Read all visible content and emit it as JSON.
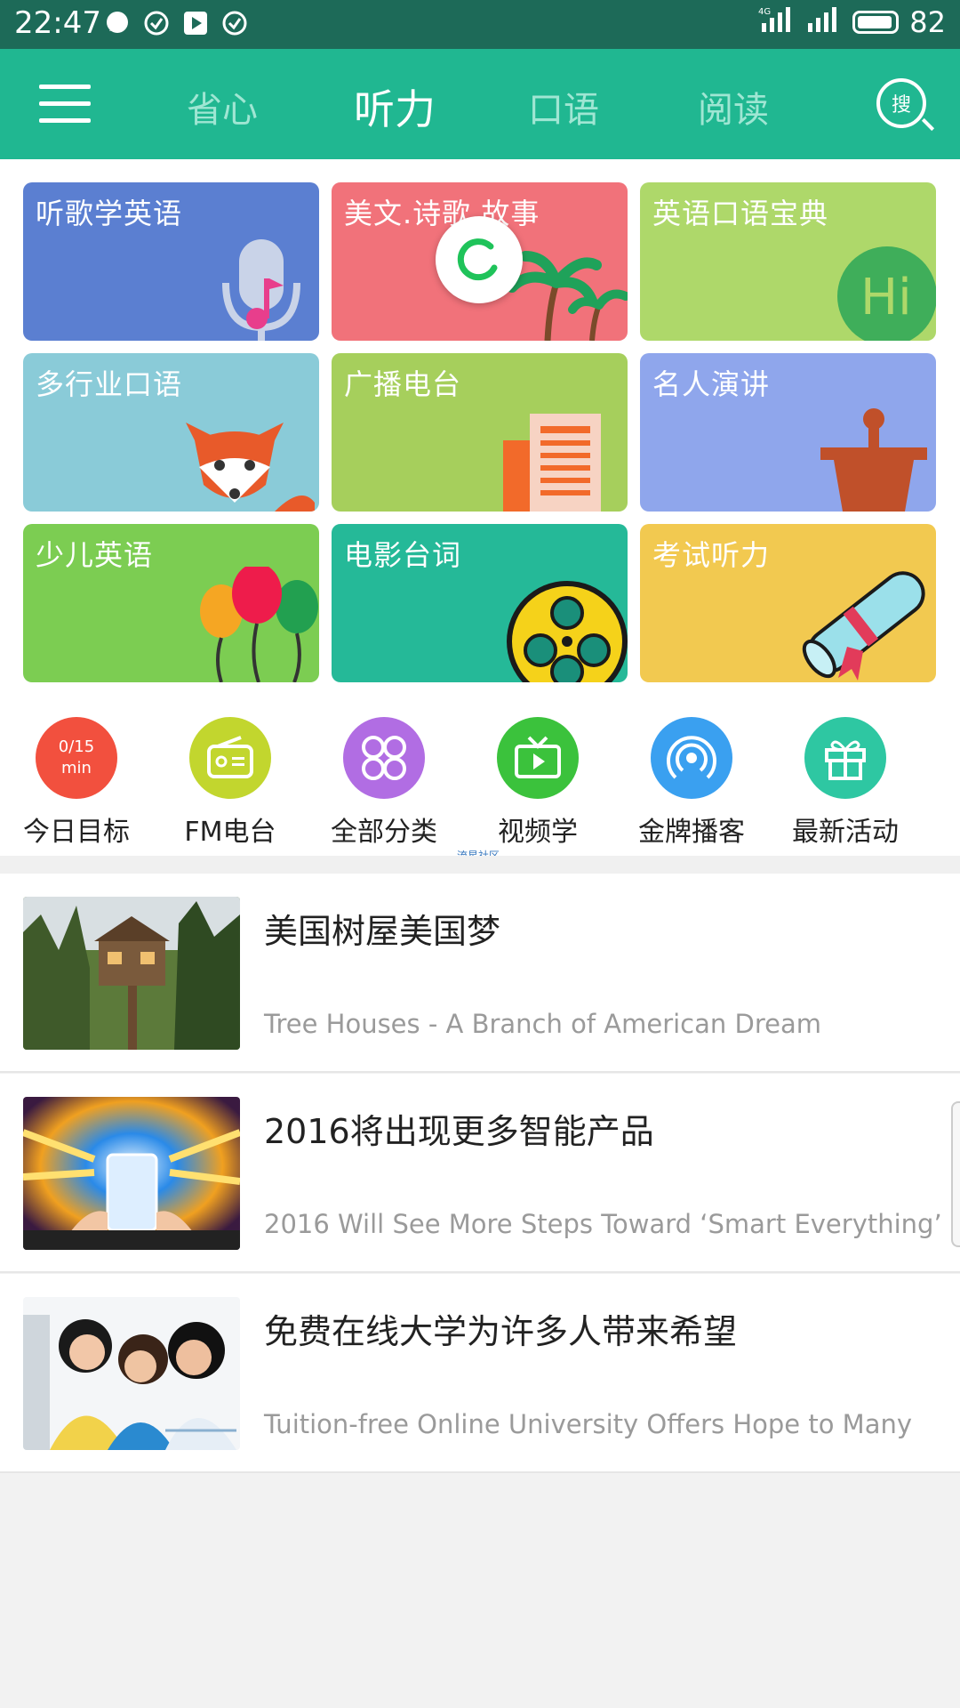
{
  "status_bar": {
    "time": "22:47",
    "network": "4G",
    "battery": "82",
    "icons": [
      "chat-bubble-icon",
      "check-circle-icon",
      "play-store-icon",
      "check-circle-icon"
    ]
  },
  "nav": {
    "menu_icon": "hamburger-icon",
    "tabs": [
      {
        "label": "省心",
        "active": false
      },
      {
        "label": "听力",
        "active": true
      },
      {
        "label": "口语",
        "active": false
      },
      {
        "label": "阅读",
        "active": false
      }
    ],
    "search_label": "搜",
    "accent": "#20b791"
  },
  "categories": [
    {
      "label": "听歌学英语",
      "color": "#5b7fd1",
      "icon": "microphone-icon"
    },
    {
      "label": "美文.诗歌.故事",
      "color": "#f1727a",
      "icon": "palm-tree-icon"
    },
    {
      "label": "英语口语宝典",
      "color": "#aed86a",
      "icon": "hi-bubble-icon"
    },
    {
      "label": "多行业口语",
      "color": "#8acbd8",
      "icon": "fox-icon"
    },
    {
      "label": "广播电台",
      "color": "#a6cf5c",
      "icon": "building-icon"
    },
    {
      "label": "名人演讲",
      "color": "#8fa6ec",
      "icon": "podium-icon"
    },
    {
      "label": "少儿英语",
      "color": "#7ccd52",
      "icon": "balloons-icon"
    },
    {
      "label": "电影台词",
      "color": "#25b998",
      "icon": "film-reel-icon"
    },
    {
      "label": "考试听力",
      "color": "#f2c950",
      "icon": "diploma-icon"
    }
  ],
  "shortcuts": [
    {
      "label": "今日目标",
      "color": "#f2503e",
      "icon": "goal-icon",
      "goal_top": "0/15",
      "goal_bottom": "min"
    },
    {
      "label": "FM电台",
      "color": "#c2d62e",
      "icon": "radio-icon"
    },
    {
      "label": "全部分类",
      "color": "#b16de3",
      "icon": "grid-icon"
    },
    {
      "label": "视频学",
      "color": "#3bc23c",
      "icon": "tv-icon"
    },
    {
      "label": "金牌播客",
      "color": "#3aa0f0",
      "icon": "podcast-icon"
    },
    {
      "label": "最新活动",
      "color": "#2ec7a2",
      "icon": "gift-icon"
    }
  ],
  "watermark": "流星社区",
  "articles": [
    {
      "title": "美国树屋美国梦",
      "subtitle": "Tree Houses - A Branch of American Dream"
    },
    {
      "title": "2016将出现更多智能产品",
      "subtitle": "2016 Will See More Steps Toward ‘Smart Everything’"
    },
    {
      "title": "免费在线大学为许多人带来希望",
      "subtitle": "Tuition-free Online University Offers Hope to Many"
    }
  ]
}
